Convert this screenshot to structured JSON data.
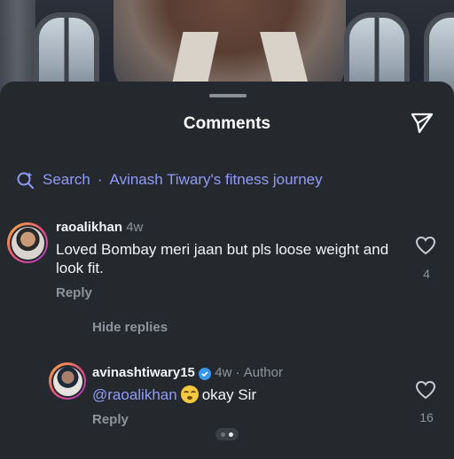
{
  "sheet": {
    "title": "Comments"
  },
  "search": {
    "label": "Search",
    "separator": "·",
    "query": "Avinash Tiwary's fitness journey"
  },
  "comments": [
    {
      "username": "raoalikhan",
      "time": "4w",
      "text": "Loved Bombay meri jaan but pls loose weight and look fit.",
      "reply_label": "Reply",
      "like_count": "4"
    }
  ],
  "hide_replies_label": "Hide replies",
  "replies": [
    {
      "username": "avinashtiwary15",
      "time": "4w",
      "separator": "·",
      "badge": "Author",
      "mention": "@raoalikhan",
      "text": "okay Sir",
      "reply_label": "Reply",
      "like_count": "16"
    }
  ],
  "icons": {
    "share": "paper-plane-icon",
    "search": "search-sparkle-icon",
    "like": "heart-outline-icon",
    "verified": "verified-badge-icon",
    "emoji": "smiling-face-icon"
  },
  "colors": {
    "background": "#25292e",
    "accent": "#8f9cf7",
    "muted": "#8e949c",
    "verified": "#3897f0"
  }
}
